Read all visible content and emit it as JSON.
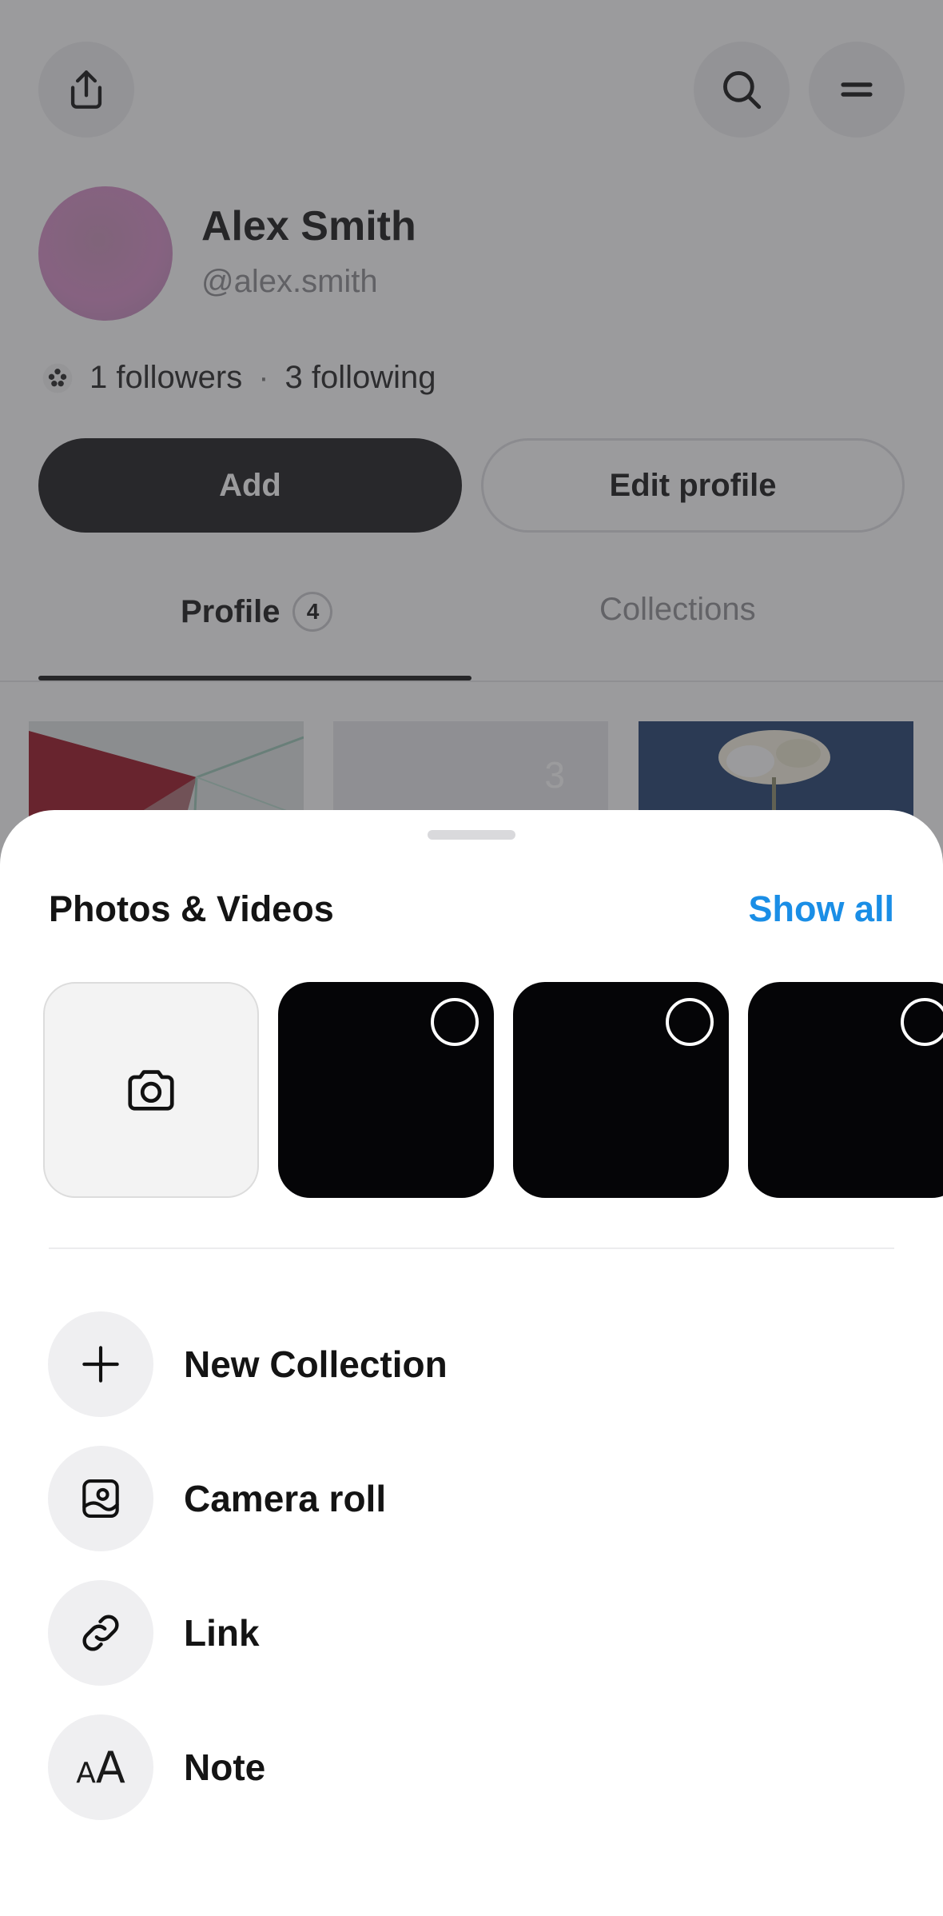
{
  "header": {
    "share_icon": "share-icon",
    "search_icon": "search-icon",
    "menu_icon": "menu-icon"
  },
  "profile": {
    "name": "Alex Smith",
    "handle": "@alex.smith",
    "followers": "1 followers",
    "separator": "·",
    "following": "3 following",
    "add_label": "Add",
    "edit_label": "Edit profile"
  },
  "tabs": {
    "profile_label": "Profile",
    "profile_count": "4",
    "collections_label": "Collections"
  },
  "grid": {
    "stack_count": "3"
  },
  "sheet": {
    "title": "Photos & Videos",
    "show_all": "Show all",
    "actions": [
      {
        "label": "New Collection",
        "icon": "plus-icon"
      },
      {
        "label": "Camera roll",
        "icon": "camera-roll-icon"
      },
      {
        "label": "Link",
        "icon": "link-icon"
      },
      {
        "label": "Note",
        "icon": "text-size-icon"
      }
    ],
    "note_icon_small": "A",
    "note_icon_big": "A"
  },
  "colors": {
    "accent": "#1a8ee6",
    "primary_button": "#18181a",
    "scrim": "rgba(55,55,60,0.5)"
  }
}
